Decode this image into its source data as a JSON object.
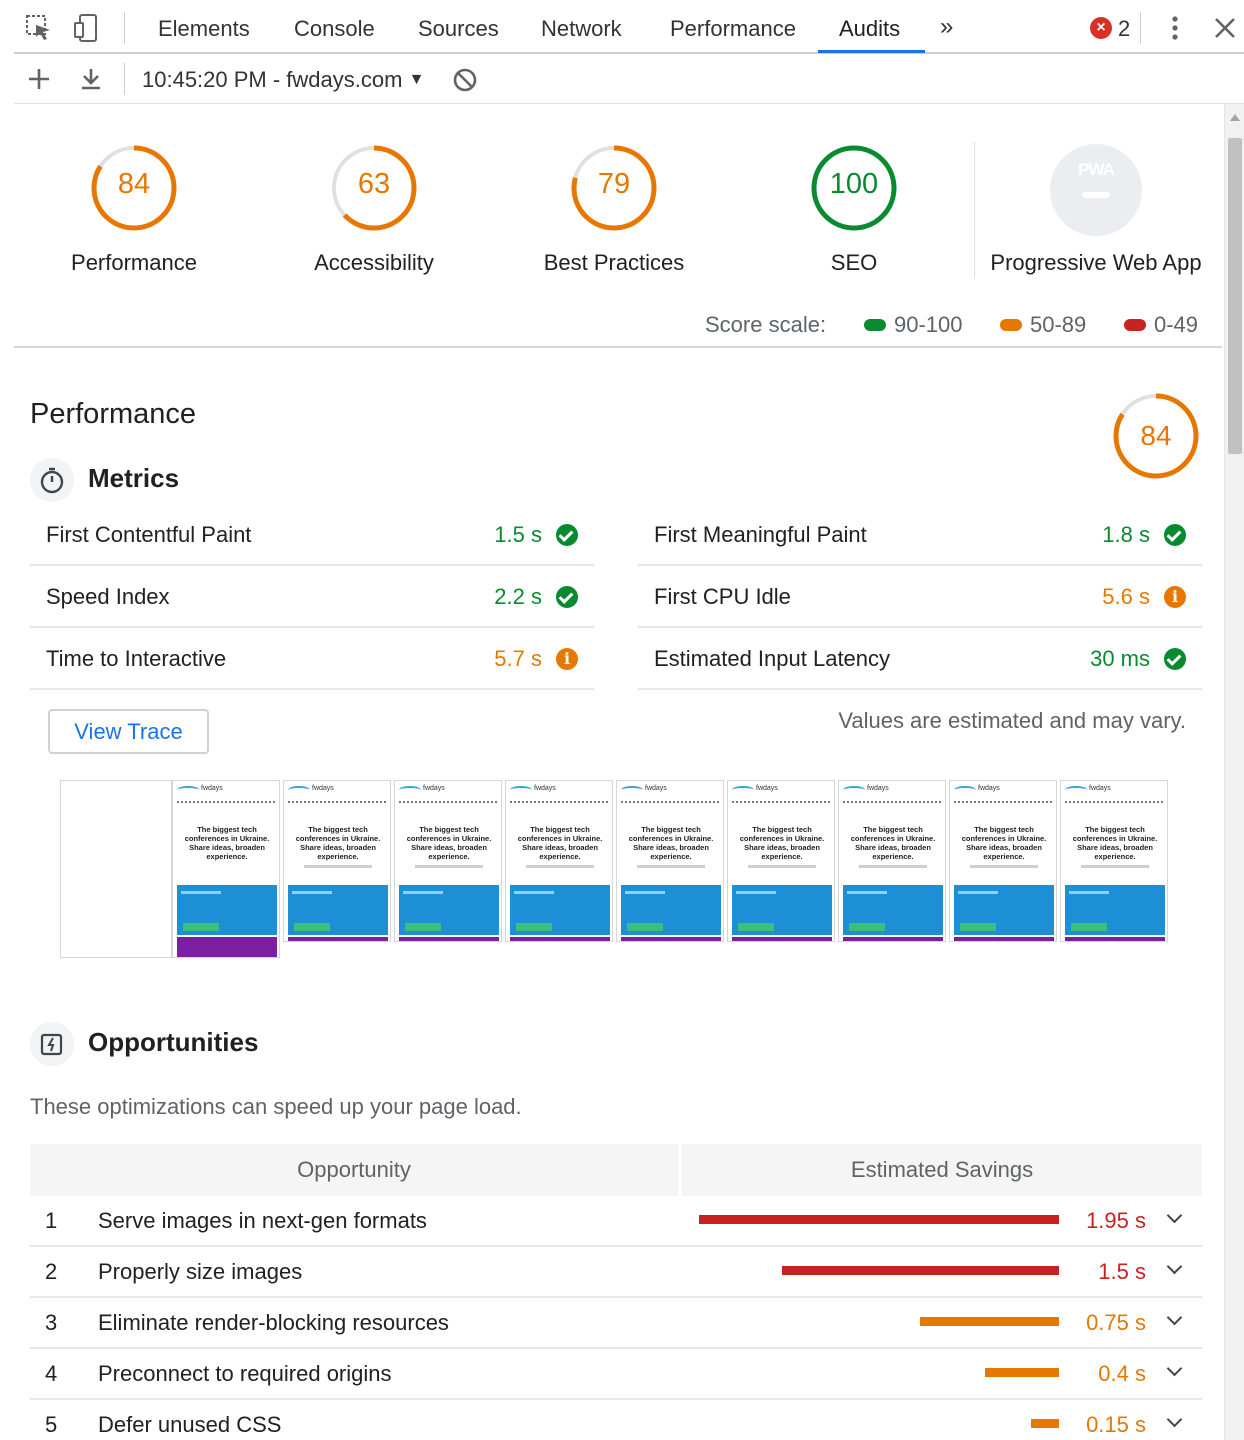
{
  "devtools": {
    "tabs": [
      "Elements",
      "Console",
      "Sources",
      "Network",
      "Performance",
      "Audits"
    ],
    "active_tab": "Audits",
    "more_tabs_glyph": "»",
    "error_count": "2"
  },
  "toolbar": {
    "report_label": "10:45:20 PM - fwdays.com",
    "dropdown_glyph": "▼"
  },
  "summary": {
    "categories": [
      {
        "label": "Performance",
        "score": "84",
        "rating": "average"
      },
      {
        "label": "Accessibility",
        "score": "63",
        "rating": "average"
      },
      {
        "label": "Best Practices",
        "score": "79",
        "rating": "average"
      },
      {
        "label": "SEO",
        "score": "100",
        "rating": "pass"
      }
    ],
    "pwa": {
      "label": "Progressive Web App",
      "badge_text": "PWA"
    },
    "scale": {
      "label": "Score scale:",
      "ranges": [
        {
          "text": "90-100",
          "color": "#0a8a2f"
        },
        {
          "text": "50-89",
          "color": "#e67700"
        },
        {
          "text": "0-49",
          "color": "#c7221f"
        }
      ]
    }
  },
  "performance": {
    "title": "Performance",
    "score": "84",
    "metrics_heading": "Metrics",
    "metrics": [
      {
        "label": "First Contentful Paint",
        "value": "1.5 s",
        "rating": "pass"
      },
      {
        "label": "First Meaningful Paint",
        "value": "1.8 s",
        "rating": "pass"
      },
      {
        "label": "Speed Index",
        "value": "2.2 s",
        "rating": "pass"
      },
      {
        "label": "First CPU Idle",
        "value": "5.6 s",
        "rating": "average"
      },
      {
        "label": "Time to Interactive",
        "value": "5.7 s",
        "rating": "average"
      },
      {
        "label": "Estimated Input Latency",
        "value": "30 ms",
        "rating": "pass"
      }
    ],
    "view_trace_label": "View Trace",
    "estimate_note": "Values are estimated and may vary.",
    "filmstrip": {
      "brand": "fwdays",
      "headline": "The biggest tech conferences in Ukraine. Share ideas, broaden experience."
    }
  },
  "opportunities": {
    "heading": "Opportunities",
    "description": "These optimizations can speed up your page load.",
    "col_opportunity": "Opportunity",
    "col_savings": "Estimated Savings",
    "items": [
      {
        "num": "1",
        "title": "Serve images in next-gen formats",
        "savings": "1.95 s",
        "rating": "fail",
        "fraction": 1.0
      },
      {
        "num": "2",
        "title": "Properly size images",
        "savings": "1.5 s",
        "rating": "fail",
        "fraction": 0.77
      },
      {
        "num": "3",
        "title": "Eliminate render-blocking resources",
        "savings": "0.75 s",
        "rating": "average",
        "fraction": 0.385
      },
      {
        "num": "4",
        "title": "Preconnect to required origins",
        "savings": "0.4 s",
        "rating": "average",
        "fraction": 0.205
      },
      {
        "num": "5",
        "title": "Defer unused CSS",
        "savings": "0.15 s",
        "rating": "average",
        "fraction": 0.077
      }
    ]
  },
  "colors": {
    "pass": "#0a8a2f",
    "average": "#e67700",
    "fail": "#c7221f",
    "accent": "#1a73e8"
  }
}
